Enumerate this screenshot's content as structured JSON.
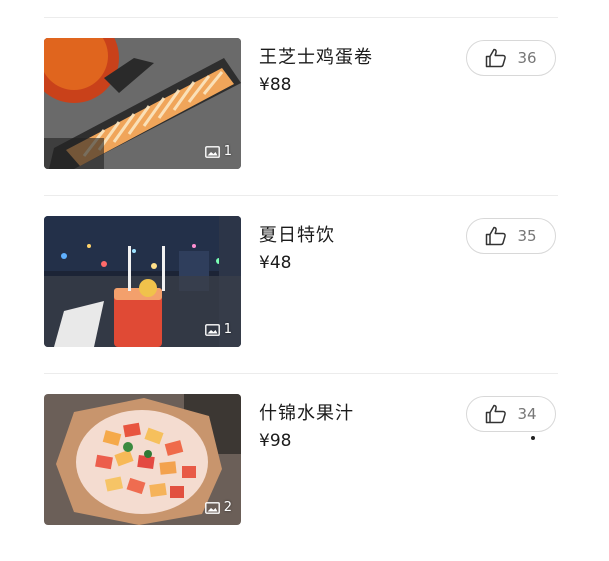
{
  "items": [
    {
      "name": "王芝士鸡蛋卷",
      "price": "¥88",
      "image_count": "1",
      "likes": "36",
      "like_icon": "thumbs-up-icon",
      "image_icon": "image-icon",
      "photo_colors": [
        "#e25b1f",
        "#f6c97a",
        "#3a3a3a"
      ]
    },
    {
      "name": "夏日特饮",
      "price": "¥48",
      "image_count": "1",
      "likes": "35",
      "like_icon": "thumbs-up-icon",
      "image_icon": "image-icon",
      "photo_colors": [
        "#18253f",
        "#e2553a",
        "#f0c24b"
      ]
    },
    {
      "name": "什锦水果汁",
      "price": "¥98",
      "image_count": "2",
      "likes": "34",
      "like_icon": "thumbs-up-icon",
      "image_icon": "image-icon",
      "photo_colors": [
        "#8a6a55",
        "#f39a55",
        "#e24e4e"
      ]
    }
  ]
}
